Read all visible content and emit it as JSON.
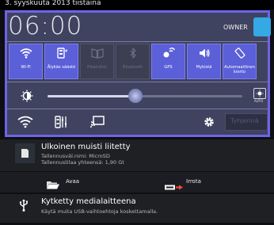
{
  "status": {
    "date": "3. syyskuuta 2013 tiistaina"
  },
  "quick_settings": {
    "time": "06:00",
    "owner": "OWNER",
    "toggles": [
      {
        "label": "Wi-Fi",
        "icon": "wifi-icon",
        "on": true
      },
      {
        "label": "Älykäs säästö",
        "icon": "smart-saving-icon",
        "on": true
      },
      {
        "label": "Pikatulkki",
        "icon": "book-icon",
        "on": false
      },
      {
        "label": "Bluetooth",
        "icon": "bluetooth-icon",
        "on": false
      },
      {
        "label": "GPS",
        "icon": "gps-icon",
        "on": true
      },
      {
        "label": "Mykistä",
        "icon": "mute-icon",
        "on": true
      },
      {
        "label": "Automaattinen kierto",
        "icon": "rotate-icon",
        "on": true
      }
    ],
    "brightness": {
      "level": 0.45,
      "auto_label": "AUTO"
    },
    "search_placeholder": "Tyhjennä"
  },
  "notifications": [
    {
      "title": "Ulkoinen muisti liitetty",
      "line1": "Tallennusväl.nimi: MicroSD",
      "line2": "Tallennustilaa yhteensä: 1,90 Gt",
      "actions": [
        {
          "label": "Avaa"
        },
        {
          "label": "Irrota"
        }
      ]
    },
    {
      "title": "Kytketty medialaitteena",
      "line1": "Käytä muita USB-vaihtoehtoja koskettamalla."
    }
  ],
  "colors": {
    "accent": "#6e63e6",
    "toggle_on": "#5b5fd8",
    "toggle_off": "#3c3f52",
    "panel": "#3f4360"
  }
}
